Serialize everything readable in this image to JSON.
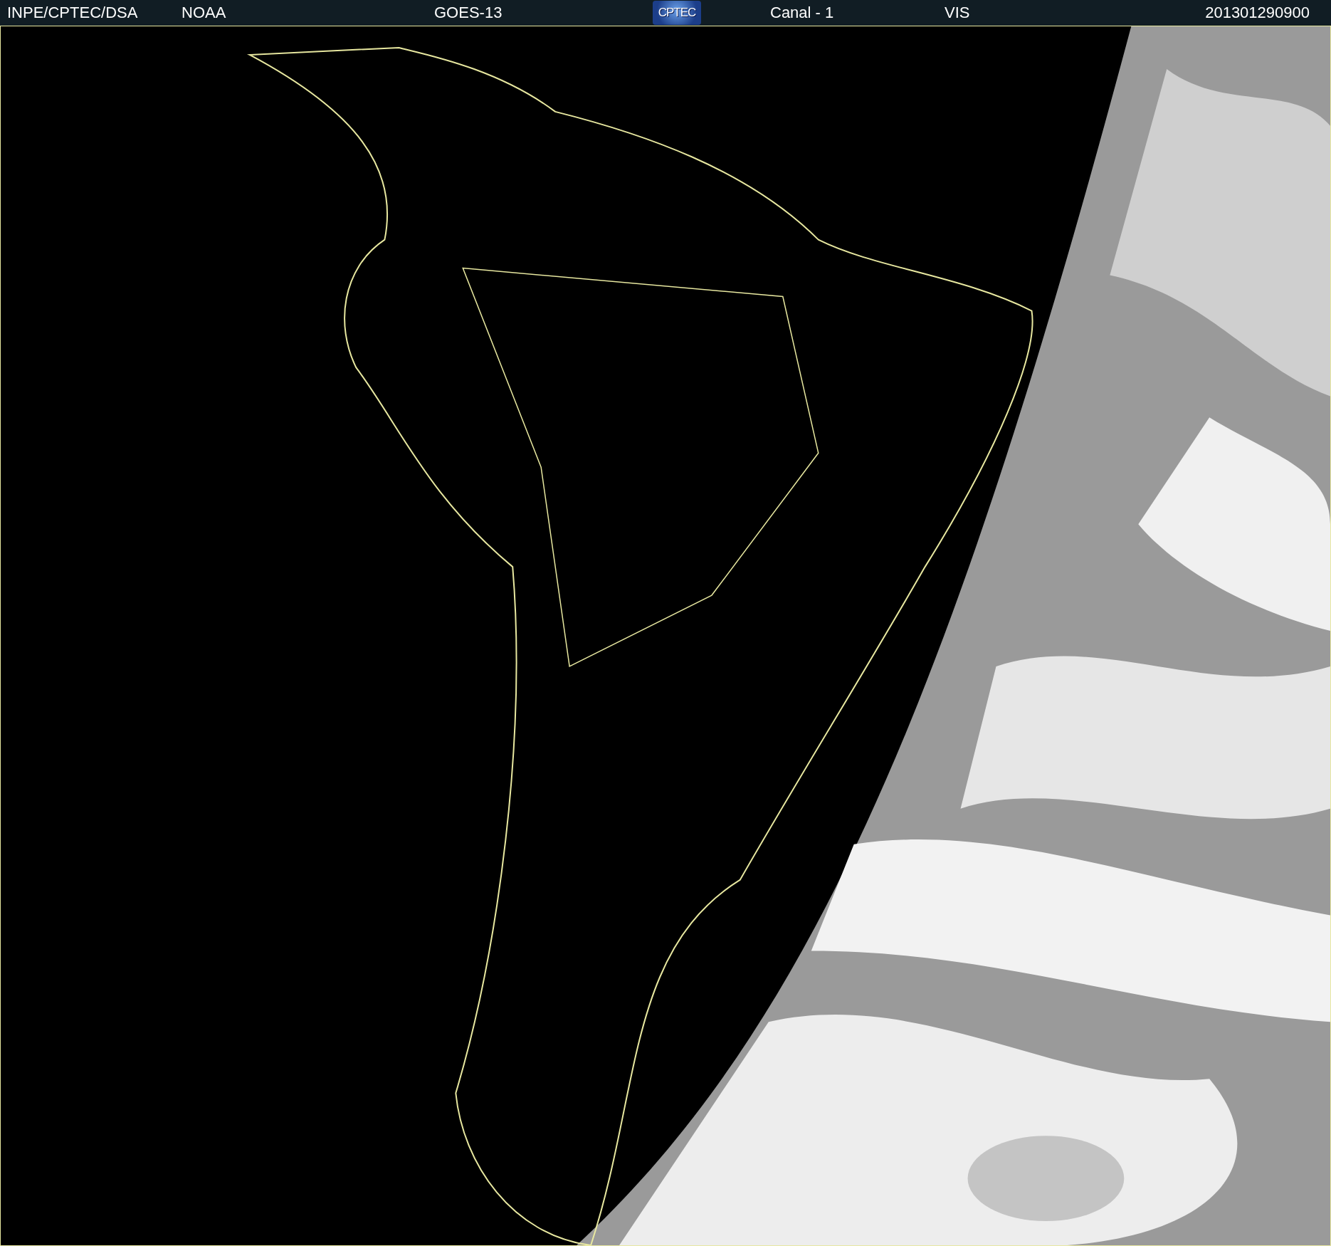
{
  "header": {
    "agency": "INPE/CPTEC/DSA",
    "source": "NOAA",
    "satellite": "GOES-13",
    "logo": "CPTEC",
    "channel": "Canal - 1",
    "band": "VIS",
    "timestamp": "201301290900"
  }
}
